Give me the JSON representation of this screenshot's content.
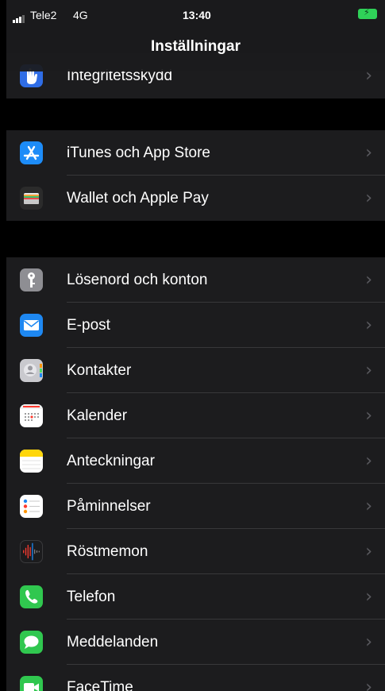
{
  "status_bar": {
    "carrier": "Tele2",
    "network": "4G",
    "time": "13:40",
    "battery_color": "#2fd158"
  },
  "header": {
    "title": "Inställningar"
  },
  "rows": [
    {
      "label": "Integritetsskydd",
      "icon": "hand-icon",
      "color": "#2f6de6"
    },
    {
      "label": "iTunes och App Store",
      "icon": "app-store-icon",
      "color": "#1d8cf8"
    },
    {
      "label": "Wallet och Apple Pay",
      "icon": "wallet-icon",
      "color": "#2b2b2b"
    },
    {
      "label": "Lösenord och konton",
      "icon": "key-icon",
      "color": "#8e8e93"
    },
    {
      "label": "E-post",
      "icon": "mail-icon",
      "color": "#1e88f2"
    },
    {
      "label": "Kontakter",
      "icon": "contacts-icon",
      "color": "#c9c9ce"
    },
    {
      "label": "Kalender",
      "icon": "calendar-icon",
      "color": "#ffffff"
    },
    {
      "label": "Anteckningar",
      "icon": "notes-icon",
      "color": "#ffd60a"
    },
    {
      "label": "Påminnelser",
      "icon": "reminders-icon",
      "color": "#ffffff"
    },
    {
      "label": "Röstmemon",
      "icon": "voice-memos-icon",
      "color": "#1c1c1e"
    },
    {
      "label": "Telefon",
      "icon": "phone-icon",
      "color": "#30c74f"
    },
    {
      "label": "Meddelanden",
      "icon": "messages-icon",
      "color": "#30c74f"
    },
    {
      "label": "FaceTime",
      "icon": "facetime-icon",
      "color": "#30c74f"
    }
  ]
}
